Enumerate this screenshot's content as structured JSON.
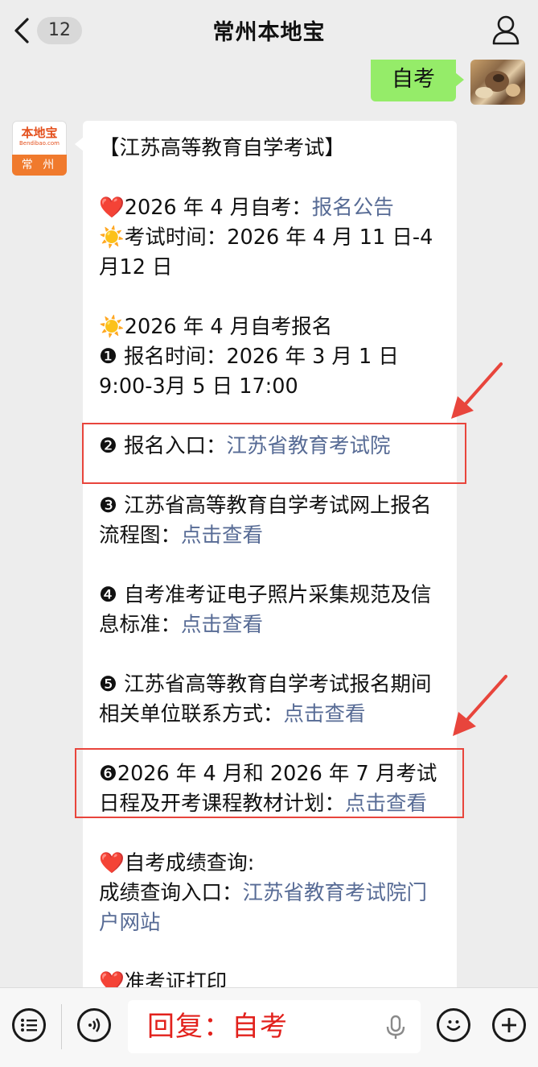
{
  "header": {
    "back_count": "12",
    "title": "常州本地宝"
  },
  "sent": {
    "text": "自考"
  },
  "logo": {
    "main": "本地宝",
    "sub": "Bendibao.com",
    "city": "常 州"
  },
  "message": {
    "title": "【江苏高等教育自学考试】",
    "heart": "❤️",
    "sun": "☀️",
    "l1_text": "2026 年 4 月自考：",
    "l1_link": "报名公告",
    "l2_text": "考试时间：2026 年 4 月 11 日-4 月12 日",
    "l3_text": "2026 年 4 月自考报名",
    "l4_text": "❶ 报名时间：2026 年 3 月 1 日 9:00-3月 5 日 17:00",
    "l5_text": "❷ 报名入口：",
    "l5_link": "江苏省教育考试院",
    "l6_text": "❸ 江苏省高等教育自学考试网上报名流程图：",
    "l6_link": "点击查看",
    "l7_text": "❹ 自考准考证电子照片采集规范及信息标准：",
    "l7_link": "点击查看",
    "l8_text": "❺ 江苏省高等教育自学考试报名期间相关单位联系方式：",
    "l8_link": "点击查看",
    "l9_text": "❻2026 年 4 月和 2026 年 7 月考试日程及开考课程教材计划：",
    "l9_link": "点击查看",
    "l10_text": "自考成绩查询:",
    "l11_text": "成绩查询入口：",
    "l11_link": "江苏省教育考试院门户网站",
    "l12_text": "准考证打印"
  },
  "input": {
    "reply_text": "回复：自考"
  },
  "colors": {
    "sent_bubble": "#95ec69",
    "link": "#576b95",
    "highlight_red": "#e8453c",
    "reply_red": "#e2211c"
  }
}
